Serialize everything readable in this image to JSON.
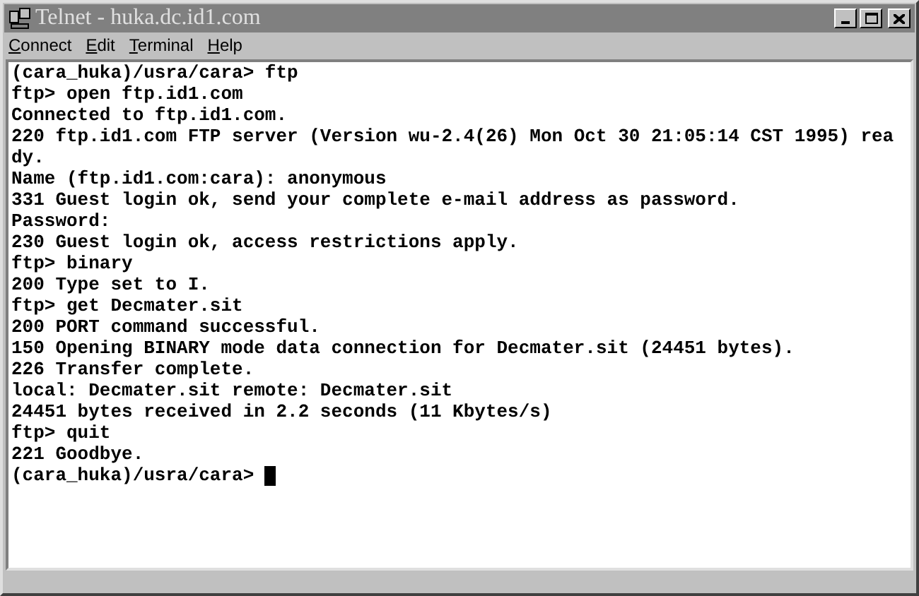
{
  "window": {
    "title": "Telnet - huka.dc.id1.com"
  },
  "menu": [
    "Connect",
    "Edit",
    "Terminal",
    "Help"
  ],
  "terminal": {
    "lines": [
      "(cara_huka)/usra/cara> ftp",
      "ftp> open ftp.id1.com",
      "Connected to ftp.id1.com.",
      "220 ftp.id1.com FTP server (Version wu-2.4(26) Mon Oct 30 21:05:14 CST 1995) rea",
      "dy.",
      "Name (ftp.id1.com:cara): anonymous",
      "331 Guest login ok, send your complete e-mail address as password.",
      "Password:",
      "230 Guest login ok, access restrictions apply.",
      "ftp> binary",
      "200 Type set to I.",
      "ftp> get Decmater.sit",
      "200 PORT command successful.",
      "150 Opening BINARY mode data connection for Decmater.sit (24451 bytes).",
      "226 Transfer complete.",
      "local: Decmater.sit remote: Decmater.sit",
      "24451 bytes received in 2.2 seconds (11 Kbytes/s)",
      "ftp> quit",
      "221 Goodbye.",
      "(cara_huka)/usra/cara> "
    ]
  }
}
